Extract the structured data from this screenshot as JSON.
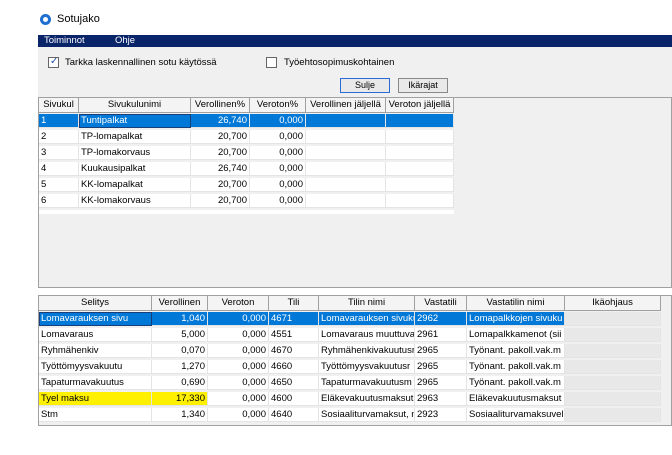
{
  "window": {
    "title": "Sotujako"
  },
  "menu": {
    "items": [
      "Toiminnot",
      "Ohje"
    ]
  },
  "options": {
    "precise_calc": {
      "label": "Tarkka laskennallinen sotu käytössä",
      "checked": true
    },
    "collective_agreement": {
      "label": "Työehtosopimuskohtainen",
      "checked": false
    }
  },
  "buttons": {
    "close": "Sulje",
    "age_limits": "Ikärajat"
  },
  "divisions_table": {
    "columns": [
      "Sivukul",
      "Sivukulunimi",
      "Verollinen%",
      "Veroton%",
      "Verollinen jäljellä",
      "Veroton jäljellä"
    ],
    "rows": [
      [
        "1",
        "Tuntipalkat",
        "26,740",
        "0,000",
        "",
        ""
      ],
      [
        "2",
        "TP-lomapalkat",
        "20,700",
        "0,000",
        "",
        ""
      ],
      [
        "3",
        "TP-lomakorvaus",
        "20,700",
        "0,000",
        "",
        ""
      ],
      [
        "4",
        "Kuukausipalkat",
        "26,740",
        "0,000",
        "",
        ""
      ],
      [
        "5",
        "KK-lomapalkat",
        "20,700",
        "0,000",
        "",
        ""
      ],
      [
        "6",
        "KK-lomakorvaus",
        "20,700",
        "0,000",
        "",
        ""
      ]
    ]
  },
  "accounts_table": {
    "columns": [
      "Selitys",
      "Verollinen",
      "Veroton",
      "Tili",
      "Tilin nimi",
      "Vastatili",
      "Vastatilin nimi",
      "Ikäohjaus"
    ],
    "rows": [
      [
        "Lomavarauksen sivu",
        "1,040",
        "0,000",
        "4671",
        "Lomavarauksen sivuku",
        "2962",
        "Lomapalkkojen sivuku",
        ""
      ],
      [
        "Lomavaraus",
        "5,000",
        "0,000",
        "4551",
        "Lomavaraus muuttuva",
        "2961",
        "Lomapalkkamenot (sii",
        ""
      ],
      [
        "Ryhmähenkiv",
        "0,070",
        "0,000",
        "4670",
        "Ryhmähenkivakuutusr",
        "2965",
        "Työnant. pakoll.vak.m",
        ""
      ],
      [
        "Työttömyysvakuutu",
        "1,270",
        "0,000",
        "4660",
        "Työttömyysvakuutusr",
        "2965",
        "Työnant. pakoll.vak.m",
        ""
      ],
      [
        "Tapaturmavakuutus",
        "0,690",
        "0,000",
        "4650",
        "Tapaturmavakuutusm",
        "2965",
        "Työnant. pakoll.vak.m",
        ""
      ],
      [
        "Tyel maksu",
        "17,330",
        "0,000",
        "4600",
        "Eläkevakuutusmaksut",
        "2963",
        "Eläkevakuutusmaksut",
        ""
      ],
      [
        "Stm",
        "1,340",
        "0,000",
        "4640",
        "Sosiaaliturvamaksut, n",
        "2923",
        "Sosiaaliturvamaksuvelk",
        ""
      ]
    ]
  },
  "colors": {
    "selection": "#0078d7",
    "menubar": "#0a246a",
    "highlight": "#fff000"
  }
}
